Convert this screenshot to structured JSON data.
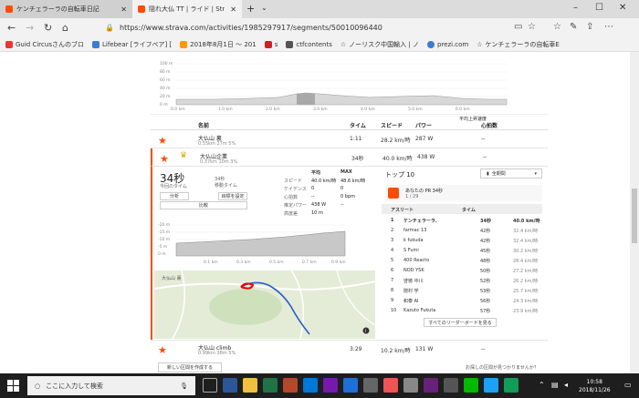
{
  "browser": {
    "tabs": [
      {
        "title": "ケンチェラーラの自転車日記",
        "active": false
      },
      {
        "title": "隠れ大仏 TT | ライド | Str",
        "active": true
      }
    ],
    "url": "https://www.strava.com/activities/1985297917/segments/50010096440",
    "bookmarks": [
      "Guid Circusさんのブロ",
      "Lifebear [ライフベア] [",
      "2018年8月1日 ～ 201",
      "s",
      "ctfcontents",
      "ノーリスク中国輸入 | ノ",
      "prezi.com",
      "ケンチェラーラの自転車E"
    ]
  },
  "elevation_top": {
    "y_labels": [
      "100 m",
      "80 m",
      "60 m",
      "40 m",
      "20 m",
      "0 m"
    ],
    "x_labels": [
      "0.0 km",
      "1.0 km",
      "2.0 km",
      "3.0 km",
      "4.0 km",
      "5.0 km",
      "6.0 km"
    ]
  },
  "segments_table": {
    "headers": {
      "name": "名前",
      "time": "タイム",
      "speed": "スピード",
      "power": "パワー",
      "hr": "心拍数",
      "avg_hr": "平均上昇速度"
    },
    "rows": [
      {
        "name": "大仏山 裏",
        "sub": "0.55km   27m   5%",
        "time": "1:11",
        "speed": "28.2 km/時",
        "power": "287 W",
        "hr": "--"
      },
      {
        "name": "大仏山企業",
        "sub": "0.37km   10m   3%",
        "time": "34秒",
        "speed": "40.0 km/時",
        "power": "438 W",
        "hr": "--"
      }
    ]
  },
  "detail": {
    "time_big": "34秒",
    "time_label": "今回のタイム",
    "moving": "34秒",
    "moving_label": "移動タイム",
    "buttons": [
      "分析",
      "目標を設定",
      "比較"
    ],
    "stats_headers": [
      "平均",
      "MAX"
    ],
    "stats": [
      {
        "label": "スピード",
        "avg": "40.0 km/時",
        "max": "48.6 km/時"
      },
      {
        "label": "ケイデンス",
        "avg": "0",
        "max": "0"
      },
      {
        "label": "心拍数",
        "avg": "--",
        "max": "0 bpm"
      },
      {
        "label": "推定パワー",
        "avg": "438 W",
        "max": "--"
      },
      {
        "label": "高度差",
        "avg": "10 m",
        "max": ""
      }
    ],
    "chart_y": [
      "-20 m",
      "-15 m",
      "-10 m",
      "-5 m",
      "0 m"
    ],
    "chart_x": [
      "0.1 km",
      "0.3 km",
      "0.5 km",
      "0.7 km",
      "0.9 km"
    ],
    "map_label": "大仏山 裏"
  },
  "leaderboard": {
    "title": "トップ 10",
    "filter": "全期間",
    "you": "あなたの PR 34秒",
    "you_sub": "1 / 29",
    "headers": {
      "athlete": "アスリート",
      "time": "タイム"
    },
    "rows": [
      {
        "rank": "1",
        "name": "ケンチェラーラ.",
        "time": "34秒",
        "speed": "40.0 km/時"
      },
      {
        "rank": "2",
        "name": "farmac 13",
        "time": "42秒",
        "speed": "32.4 km/時"
      },
      {
        "rank": "3",
        "name": "k fukuda",
        "time": "42秒",
        "speed": "32.4 km/時"
      },
      {
        "rank": "4",
        "name": "S Fumi",
        "time": "45秒",
        "speed": "30.2 km/時"
      },
      {
        "rank": "5",
        "name": "400 Reacto",
        "time": "48秒",
        "speed": "28.4 km/時"
      },
      {
        "rank": "6",
        "name": "NOD YSK",
        "time": "50秒",
        "speed": "27.2 km/時"
      },
      {
        "rank": "7",
        "name": "啓徳 中川",
        "time": "52秒",
        "speed": "26.2 km/時"
      },
      {
        "rank": "8",
        "name": "隠村 学",
        "time": "53秒",
        "speed": "25.7 km/時"
      },
      {
        "rank": "9",
        "name": "和泰 AI",
        "time": "56秒",
        "speed": "24.3 km/時"
      },
      {
        "rank": "10",
        "name": "Kazuto Fukuta",
        "time": "57秒",
        "speed": "23.9 km/時"
      }
    ],
    "all_button": "すべてのリーダーボードを見る"
  },
  "bottom_row": {
    "name": "大仏山 climb",
    "sub": "0.99km   38m   5%",
    "time": "3:29",
    "speed": "10.2 km/時",
    "power": "131 W",
    "hr": "--"
  },
  "footer": {
    "create": "新しい区間を作成する",
    "help": "お探しの区間が見つかりませんか？"
  },
  "taskbar": {
    "search_placeholder": "ここに入力して検索",
    "time": "10:58",
    "date": "2018/11/26"
  },
  "colors": {
    "strava_orange": "#fc4c02",
    "crown": "#e6a600"
  }
}
